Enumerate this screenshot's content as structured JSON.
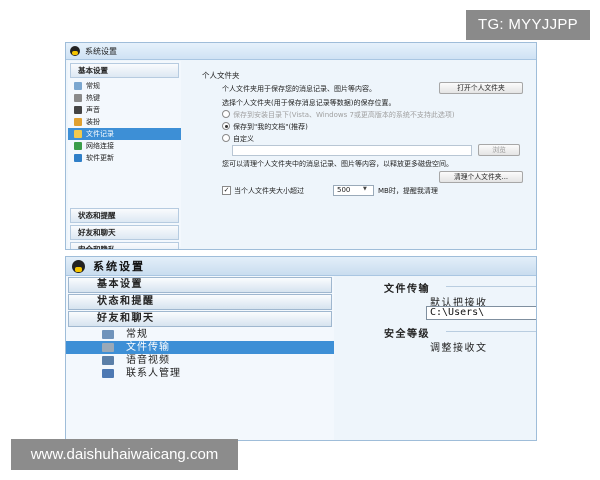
{
  "watermarks": {
    "top": "TG: MYYJJPP",
    "bottom": "www.daishuhaiwaicang.com"
  },
  "top_window": {
    "title": "系统设置",
    "categories": [
      "基本设置",
      "状态和提醒",
      "好友和聊天",
      "安全和隐私"
    ],
    "subitems": [
      {
        "label": "常规",
        "icon": "settings-icon",
        "color": "#7aa6cf"
      },
      {
        "label": "热键",
        "icon": "keyboard-icon",
        "color": "#8a8a8a"
      },
      {
        "label": "声音",
        "icon": "speaker-icon",
        "color": "#444444"
      },
      {
        "label": "装扮",
        "icon": "paint-icon",
        "color": "#e0a030"
      },
      {
        "label": "文件记录",
        "icon": "folder-icon",
        "color": "#f2c94c"
      },
      {
        "label": "网络连接",
        "icon": "network-icon",
        "color": "#3a9d4a"
      },
      {
        "label": "软件更新",
        "icon": "update-icon",
        "color": "#2f7fc8"
      }
    ],
    "selected_index": 4,
    "panel": {
      "section_title": "个人文件夹",
      "desc": "个人文件夹用于保存您的消息记录、图片等内容。",
      "open_button": "打开个人文件夹",
      "choose_label": "选择个人文件夹(用于保存消息记录等数据)的保存位置。",
      "radio_options": [
        "保存到安装目录下(Vista、Windows 7或更高版本的系统不支持此选项)",
        "保存到\"我的文档\"(推荐)",
        "自定义"
      ],
      "radio_selected": 1,
      "custom_path": "",
      "browse_button": "浏览",
      "clear_desc": "您可以清理个人文件夹中的消息记录、图片等内容，以释放更多磁盘空间。",
      "clear_button": "清理个人文件夹...",
      "size_check_prefix": "当个人文件夹大小超过",
      "size_value": "500",
      "size_check_suffix": "MB时，提醒我清理",
      "size_checked": true
    }
  },
  "bottom_window": {
    "title": "系统设置",
    "categories": [
      "基本设置",
      "状态和提醒",
      "好友和聊天"
    ],
    "subitems": [
      {
        "label": "常规",
        "icon": "settings-icon",
        "color": "#6f93bb"
      },
      {
        "label": "文件传输",
        "icon": "file-transfer-icon",
        "color": "#9aa9b8"
      },
      {
        "label": "语音视频",
        "icon": "video-icon",
        "color": "#5a7fa8"
      },
      {
        "label": "联系人管理",
        "icon": "contacts-icon",
        "color": "#4d79b3"
      }
    ],
    "selected_index": 1,
    "panel": {
      "section1": "文件传输",
      "default_receive": "默认把接收",
      "path": "C:\\Users\\",
      "section2": "安全等级",
      "adjust": "调整接收文"
    }
  }
}
